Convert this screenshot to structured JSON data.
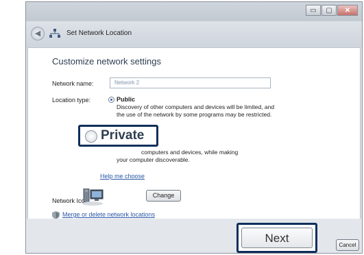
{
  "window": {
    "title": "Set Network Location",
    "blurred_caption": "",
    "controls": {
      "minimize": "▭",
      "maximize": "▢",
      "close": "✕"
    }
  },
  "navbar": {
    "back_label": "◀",
    "network_icon": "network-icon",
    "title": "Set Network Location",
    "blurred_text": ""
  },
  "page": {
    "heading": "Customize network settings",
    "network_name_label": "Network name:",
    "network_name_value": "Network 2",
    "location_type_label": "Location type:",
    "public": {
      "label": "Public",
      "selected": true,
      "description_line1": "Discovery of other computers and devices will be limited, and",
      "description_line2": "the use of the network by some programs may be restricted."
    },
    "private": {
      "label": "Private",
      "selected": false,
      "description_line1": "computers and devices, while making",
      "description_line2": "your computer discoverable."
    },
    "help_link": "Help me choose",
    "network_icon_label": "Network Icon:",
    "change_button": "Change",
    "merge_link": "Merge or delete network locations"
  },
  "footer": {
    "next_button": "Next",
    "cancel_button": "Cancel"
  },
  "colors": {
    "highlight_border": "#0e2f5a",
    "link": "#2a57a6"
  }
}
